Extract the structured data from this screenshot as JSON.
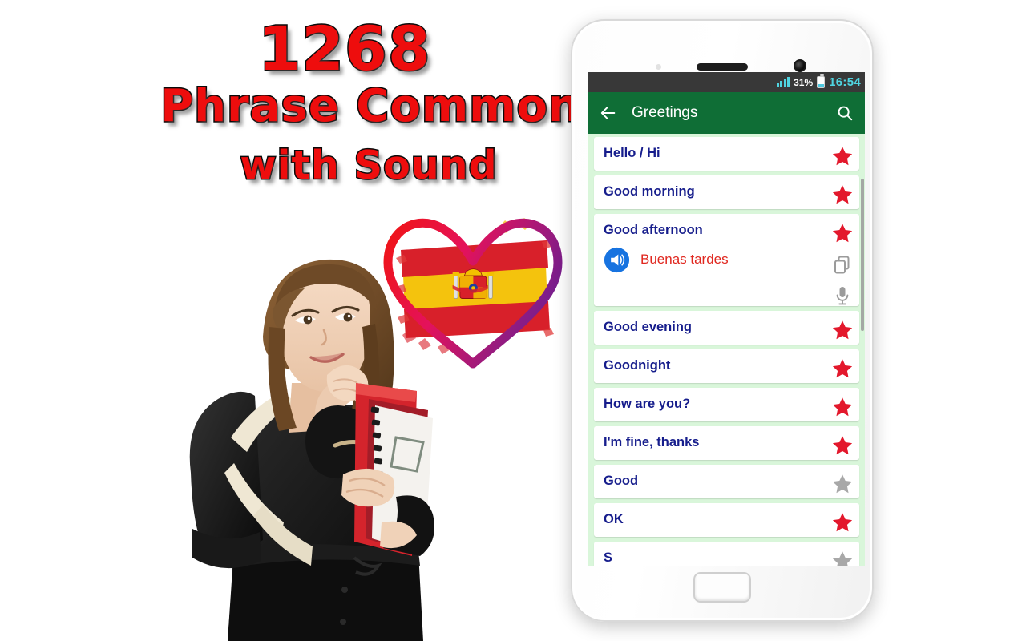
{
  "promo": {
    "count": "1268",
    "line1": "Phrase Common",
    "line2": "with Sound",
    "title_color": "#ee0d0d",
    "outline_color": "#0a0a0a",
    "emblem_name": "spain-flag-heart",
    "photo_name": "student-girl-with-backpack-and-books"
  },
  "phone": {
    "statusbar": {
      "signal_icon": "signal-bars-icon",
      "battery_percent": "31%",
      "battery_icon": "battery-icon",
      "time": "16:54",
      "background": "#383838",
      "accent": "#4fd4e0"
    },
    "appbar": {
      "back_icon": "back-arrow-icon",
      "title": "Greetings",
      "search_icon": "search-icon",
      "background": "#0f6e36"
    },
    "list": {
      "background": "#d9f6da",
      "phrase_color": "#161d8c",
      "translation_color": "#e0271f",
      "star_active_color": "#e3182c",
      "star_inactive_color": "#a8a8a8",
      "items": [
        {
          "phrase": "Hello / Hi",
          "starred": true,
          "expanded": false
        },
        {
          "phrase": "Good morning",
          "starred": true,
          "expanded": false
        },
        {
          "phrase": "Good afternoon",
          "starred": true,
          "expanded": true,
          "translation": "Buenas tardes",
          "speaker_icon": "speaker-icon",
          "copy_icon": "copy-icon",
          "mic_icon": "microphone-icon"
        },
        {
          "phrase": "Good evening",
          "starred": true,
          "expanded": false
        },
        {
          "phrase": "Goodnight",
          "starred": true,
          "expanded": false
        },
        {
          "phrase": "How are you?",
          "starred": true,
          "expanded": false
        },
        {
          "phrase": "I'm fine, thanks",
          "starred": true,
          "expanded": false
        },
        {
          "phrase": "Good",
          "starred": false,
          "expanded": false
        },
        {
          "phrase": "OK",
          "starred": true,
          "expanded": false
        },
        {
          "phrase": "S",
          "starred": false,
          "expanded": false,
          "clipped": true
        }
      ]
    },
    "home_button_name": "home-button",
    "earpiece_name": "earpiece-speaker",
    "camera_name": "front-camera"
  }
}
